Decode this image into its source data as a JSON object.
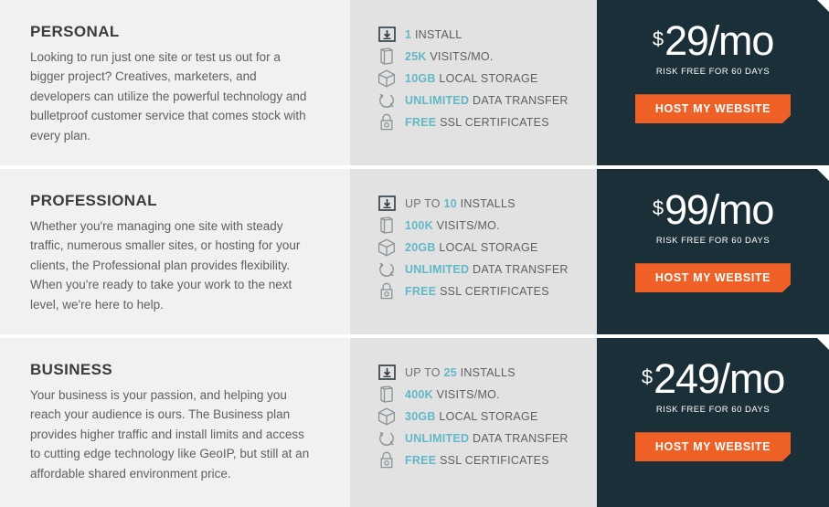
{
  "accent": {
    "teal": "#62b8c6",
    "orange": "#ef6026",
    "dark_panel": "#1b2f38",
    "desc_bg": "#f1f1f1",
    "features_bg": "#e2e2e2"
  },
  "plans": [
    {
      "name": "PERSONAL",
      "description": "Looking to run just one site or test us out for a bigger project? Creatives, marketers, and developers can utilize the powerful technology and bulletproof customer service that comes stock with every plan.",
      "features": [
        {
          "icon": "install-icon",
          "prefix": "",
          "value": "1",
          "suffix": "INSTALL"
        },
        {
          "icon": "visits-icon",
          "prefix": "",
          "value": "25K",
          "suffix": "VISITS/MO."
        },
        {
          "icon": "storage-icon",
          "prefix": "",
          "value": "10GB",
          "suffix": "LOCAL STORAGE"
        },
        {
          "icon": "transfer-icon",
          "prefix": "",
          "value": "UNLIMITED",
          "suffix": "DATA TRANSFER"
        },
        {
          "icon": "ssl-lock-icon",
          "prefix": "",
          "value": "FREE",
          "suffix": "SSL CERTIFICATES"
        }
      ],
      "currency": "$",
      "price": "29/mo",
      "risk_note": "RISK FREE FOR 60 DAYS",
      "cta_label": "HOST MY WEBSITE"
    },
    {
      "name": "PROFESSIONAL",
      "description": "Whether you're managing one site with steady traffic, numerous smaller sites, or hosting for your clients, the Professional plan provides flexibility. When you're ready to take your work to the next level, we're here to help.",
      "features": [
        {
          "icon": "install-icon",
          "prefix": "UP TO",
          "value": "10",
          "suffix": "INSTALLS"
        },
        {
          "icon": "visits-icon",
          "prefix": "",
          "value": "100K",
          "suffix": "VISITS/MO."
        },
        {
          "icon": "storage-icon",
          "prefix": "",
          "value": "20GB",
          "suffix": "LOCAL STORAGE"
        },
        {
          "icon": "transfer-icon",
          "prefix": "",
          "value": "UNLIMITED",
          "suffix": "DATA TRANSFER"
        },
        {
          "icon": "ssl-lock-icon",
          "prefix": "",
          "value": "FREE",
          "suffix": "SSL CERTIFICATES"
        }
      ],
      "currency": "$",
      "price": "99/mo",
      "risk_note": "RISK FREE FOR 60 DAYS",
      "cta_label": "HOST MY WEBSITE"
    },
    {
      "name": "BUSINESS",
      "description": "Your business is your passion, and helping you reach your audience is ours. The Business plan provides higher traffic and install limits and access to cutting edge technology like GeoIP, but still at an affordable shared environment price.",
      "features": [
        {
          "icon": "install-icon",
          "prefix": "UP TO",
          "value": "25",
          "suffix": "INSTALLS"
        },
        {
          "icon": "visits-icon",
          "prefix": "",
          "value": "400K",
          "suffix": "VISITS/MO."
        },
        {
          "icon": "storage-icon",
          "prefix": "",
          "value": "30GB",
          "suffix": "LOCAL STORAGE"
        },
        {
          "icon": "transfer-icon",
          "prefix": "",
          "value": "UNLIMITED",
          "suffix": "DATA TRANSFER"
        },
        {
          "icon": "ssl-lock-icon",
          "prefix": "",
          "value": "FREE",
          "suffix": "SSL CERTIFICATES"
        }
      ],
      "currency": "$",
      "price": "249/mo",
      "risk_note": "RISK FREE FOR 60 DAYS",
      "cta_label": "HOST MY WEBSITE"
    }
  ]
}
